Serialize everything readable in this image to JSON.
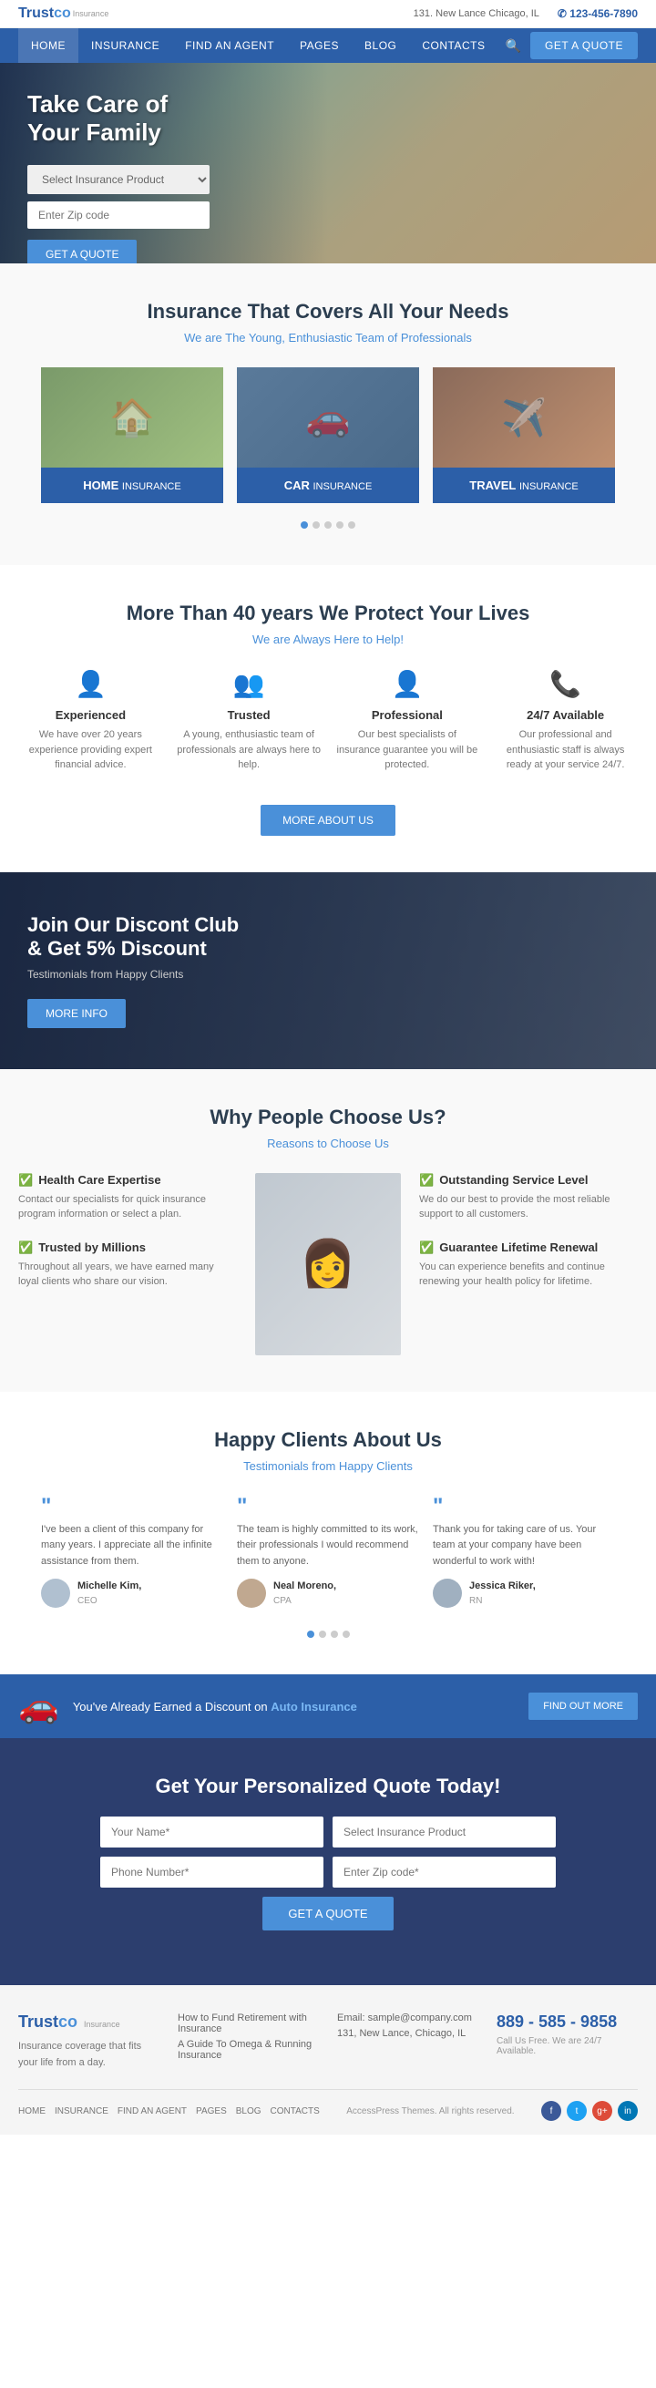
{
  "topbar": {
    "logo_trust": "Trust",
    "logo_co": "co",
    "logo_ins": "Insurance",
    "address": "131. New Lance Chicago, IL",
    "phone": "✆ 123-456-7890"
  },
  "nav": {
    "links": [
      "HOME",
      "INSURANCE",
      "FIND AN AGENT",
      "PAGES",
      "BLOG",
      "CONTACTS"
    ],
    "cta": "GET A QUOTE"
  },
  "hero": {
    "title": "Take Care of\nYour Family",
    "form_placeholder_product": "Select Insurance Product",
    "form_placeholder_zip": "Enter Zip code",
    "cta": "GET A QUOTE"
  },
  "insurance": {
    "title": "Insurance That Covers All Your Needs",
    "subtitle": "We are The Young, Enthusiastic Team of Professionals",
    "cards": [
      {
        "label_strong": "HOME",
        "label_light": "Insurance"
      },
      {
        "label_strong": "CAR",
        "label_light": "Insurance"
      },
      {
        "label_strong": "TRAVEL",
        "label_light": "Insurance"
      }
    ]
  },
  "trust": {
    "title": "More Than 40 years We Protect Your Lives",
    "subtitle": "We are Always Here to Help!",
    "features": [
      {
        "icon": "👤",
        "title": "Experienced",
        "desc": "We have over 20 years experience providing expert financial advice."
      },
      {
        "icon": "👥",
        "title": "Trusted",
        "desc": "A young, enthusiastic team of professionals are always here to help."
      },
      {
        "icon": "👤",
        "title": "Professional",
        "desc": "Our best specialists of insurance guarantee you will be protected."
      },
      {
        "icon": "📞",
        "title": "24/7 Available",
        "desc": "Our professional and enthusiastic staff is always ready at your service 24/7."
      }
    ],
    "cta": "MORE ABOUT US"
  },
  "discount": {
    "title": "Join Our Discont Club\n& Get 5% Discount",
    "subtitle": "Testimonials from Happy Clients",
    "cta": "MORE INFO"
  },
  "why": {
    "title": "Why People Choose Us?",
    "subtitle": "Reasons to Choose Us",
    "items_left": [
      {
        "title": "Health Care Expertise",
        "desc": "Contact our specialists for quick insurance program information or select a plan."
      },
      {
        "title": "Trusted by Millions",
        "desc": "Throughout all years, we have earned many loyal clients who share our vision."
      }
    ],
    "items_right": [
      {
        "title": "Outstanding Service Level",
        "desc": "We do our best to provide the most reliable support to all customers."
      },
      {
        "title": "Guarantee Lifetime Renewal",
        "desc": "You can experience benefits and continue renewing your health policy for lifetime."
      }
    ]
  },
  "testimonials": {
    "title": "Happy Clients About Us",
    "subtitle": "Testimonials from Happy Clients",
    "items": [
      {
        "text": "I've been a client of this company for many years. I appreciate all the infinite assistance from them.",
        "name": "Michelle Kim,",
        "role": "CEO"
      },
      {
        "text": "The team is highly committed to its work, their professionals I would recommend them to anyone.",
        "name": "Neal Moreno,",
        "role": "CPA"
      },
      {
        "text": "Thank you for taking care of us. Your team at your company have been wonderful to work with!",
        "name": "Jessica Riker,",
        "role": "RN"
      }
    ]
  },
  "auto_banner": {
    "text_before": "You've Already Earned a Discount on",
    "text_link": "Auto Insurance",
    "cta": "FIND OUT MORE"
  },
  "quote_form": {
    "title": "Get Your Personalized Quote Today!",
    "fields": [
      {
        "placeholder": "Your Name*",
        "type": "text"
      },
      {
        "placeholder": "Select Insurance Product",
        "type": "text"
      },
      {
        "placeholder": "Phone Number*",
        "type": "text"
      },
      {
        "placeholder": "Enter Zip code*",
        "type": "text"
      }
    ],
    "cta": "GET A QUOTE"
  },
  "footer": {
    "logo_trust": "Trust",
    "logo_co": "co",
    "logo_ins": "Insurance",
    "desc": "Insurance coverage that fits your life from a day.",
    "links_col1_title": "How to Fund Retirement with Insurance",
    "links_col1": [
      "How to Fund Retirement with Insurance",
      "A Guide To Omega & Running Insurance"
    ],
    "contact_email_label": "Email:",
    "contact_email": "sample@company.com",
    "contact_address": "131, New Lance, Chicago, IL",
    "contact_phone": "889 - 585 - 9858",
    "contact_phone_sub": "Call Us Free. We are 24/7 Available.",
    "nav_links": [
      "HOME",
      "INSURANCE",
      "FIND AN AGENT",
      "PAGES",
      "BLOG",
      "CONTACTS"
    ],
    "copyright": "AccessPress Themes. All rights reserved."
  }
}
